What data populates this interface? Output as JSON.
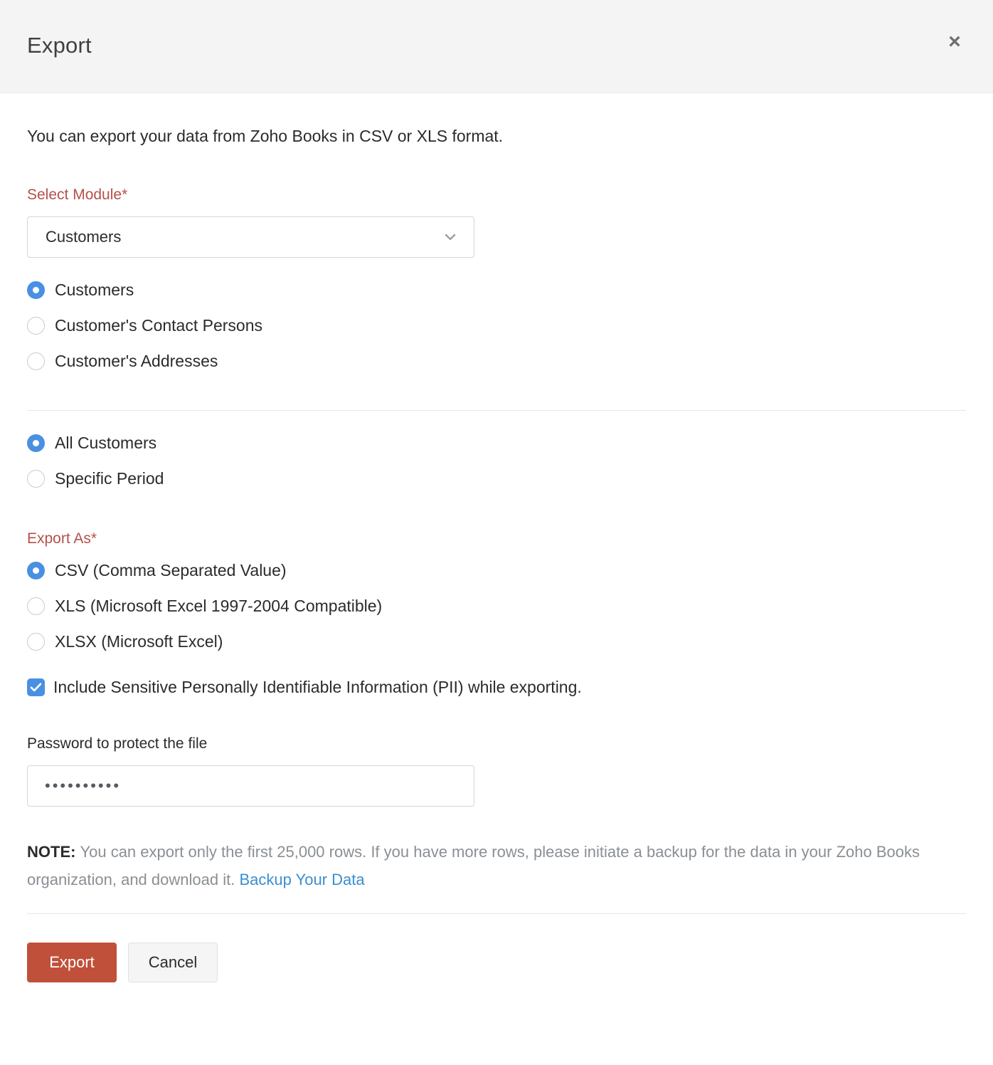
{
  "dialog": {
    "title": "Export",
    "close_icon": "close-icon",
    "intro": "You can export your data from Zoho Books in CSV or XLS format."
  },
  "module_field": {
    "label": "Select Module*",
    "selected": "Customers",
    "chevron_icon": "chevron-down-icon",
    "options": [
      "Customers"
    ]
  },
  "module_scope": {
    "options": [
      {
        "label": "Customers",
        "checked": true
      },
      {
        "label": "Customer's Contact Persons",
        "checked": false
      },
      {
        "label": "Customer's Addresses",
        "checked": false
      }
    ]
  },
  "period_scope": {
    "options": [
      {
        "label": "All Customers",
        "checked": true
      },
      {
        "label": "Specific Period",
        "checked": false
      }
    ]
  },
  "export_as": {
    "label": "Export As*",
    "options": [
      {
        "label": "CSV (Comma Separated Value)",
        "checked": true
      },
      {
        "label": "XLS (Microsoft Excel 1997-2004 Compatible)",
        "checked": false
      },
      {
        "label": "XLSX (Microsoft Excel)",
        "checked": false
      }
    ]
  },
  "pii": {
    "label": "Include Sensitive Personally Identifiable Information (PII) while exporting.",
    "checked": true,
    "check_icon": "check-icon"
  },
  "password": {
    "label": "Password to protect the file",
    "value": "••••••••••",
    "placeholder": ""
  },
  "note": {
    "label": "NOTE:",
    "text": "You can export only the first 25,000 rows. If you have more rows, please initiate a backup for the data in your Zoho Books organization, and download it.",
    "link_text": "Backup Your Data"
  },
  "footer": {
    "export_label": "Export",
    "cancel_label": "Cancel"
  },
  "colors": {
    "primary_button": "#c0503a",
    "required_label": "#b5504a",
    "accent_blue": "#4a90e2",
    "link_blue": "#3b8ed0",
    "header_bg": "#f4f4f4"
  }
}
